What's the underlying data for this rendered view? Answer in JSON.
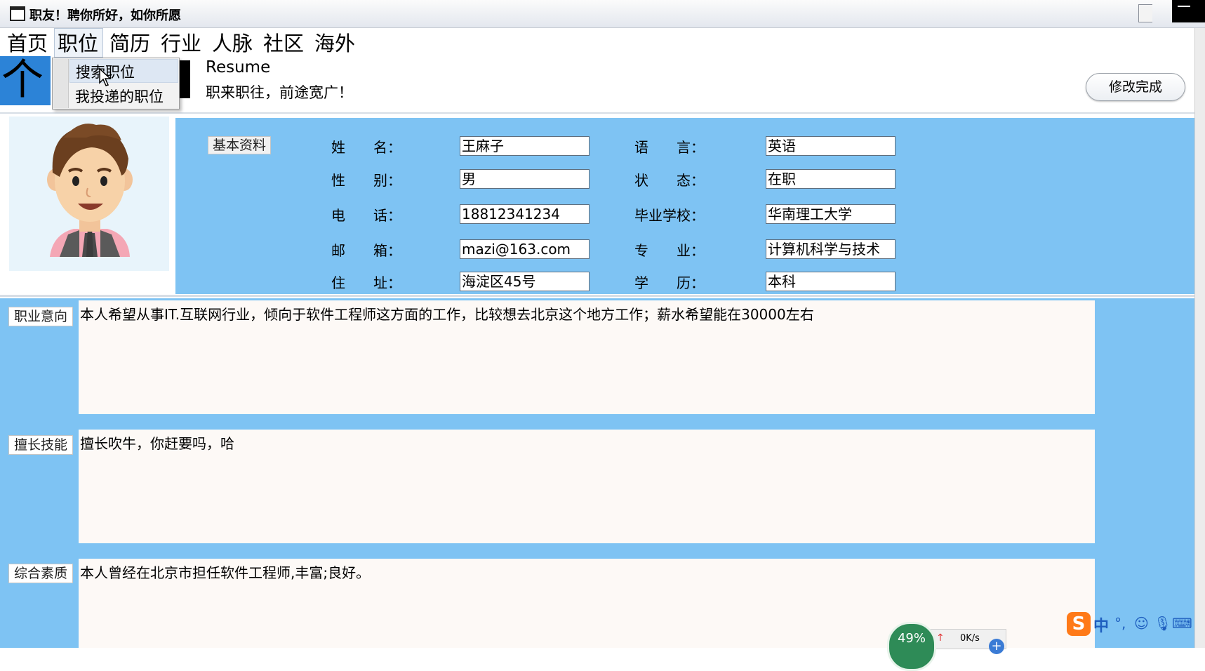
{
  "window": {
    "title": "职友！聘你所好，如你所愿"
  },
  "menu": [
    "首页",
    "职位",
    "简历",
    "行业",
    "人脉",
    "社区",
    "海外"
  ],
  "dropdown": {
    "items": [
      "搜索职位",
      "我投递的职位"
    ]
  },
  "header": {
    "big_title": "个人",
    "resume_en": "Resume",
    "slogan": "职来职往，前途宽广！",
    "done_button": "修改完成"
  },
  "basic": {
    "tag": "基本资料",
    "fields": [
      {
        "label": "姓　　名：",
        "value": "王麻子"
      },
      {
        "label": "性　　别：",
        "value": "男"
      },
      {
        "label": "电　　话：",
        "value": "18812341234"
      },
      {
        "label": "邮　　箱：",
        "value": "mazi@163.com"
      },
      {
        "label": "住　　址：",
        "value": "海淀区45号"
      },
      {
        "label": "语　　言：",
        "value": "英语"
      },
      {
        "label": "状　　态：",
        "value": "在职"
      },
      {
        "label": "毕业学校：",
        "value": "华南理工大学"
      },
      {
        "label": "专　　业：",
        "value": "计算机科学与技术"
      },
      {
        "label": "学　　历：",
        "value": "本科"
      }
    ]
  },
  "sections": [
    {
      "tag": "职业意向",
      "text": "本人希望从事IT.互联网行业，倾向于软件工程师这方面的工作，比较想去北京这个地方工作；薪水希望能在30000左右"
    },
    {
      "tag": "擅长技能",
      "text": "擅长吹牛，你赶要吗，哈"
    },
    {
      "tag": "综合素质",
      "text": "本人曾经在北京市担任软件工程师,丰富;良好。"
    }
  ],
  "tray": {
    "ime_logo": "S",
    "ime_lang": "中",
    "net_percent": "49%",
    "net_speed": "0K/s"
  },
  "colors": {
    "panel_blue": "#7ec3f3",
    "title_blue": "#2c83d7",
    "text_box": "#fdf9f6"
  }
}
